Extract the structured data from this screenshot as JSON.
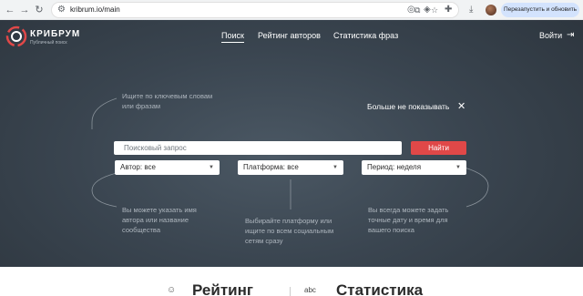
{
  "browser": {
    "url": "kribrum.io/main",
    "relaunch_label": "Перезапустить и обновить"
  },
  "header": {
    "brand": "КРИБРУМ",
    "brand_sub": "Публичный поиск",
    "nav": [
      {
        "label": "Поиск",
        "active": true
      },
      {
        "label": "Рейтинг авторов",
        "active": false
      },
      {
        "label": "Статистика фраз",
        "active": false
      }
    ],
    "login_label": "Войти"
  },
  "hints": {
    "search": "Ищите по ключевым словам или фразам",
    "author": "Вы можете указать имя автора или название сообщества",
    "platform": "Выбирайте платформу или ищите по всем социальным сетям сразу",
    "period": "Вы всегда можете задать точные дату и время для вашего поиска"
  },
  "dismiss_label": "Больше не показывать",
  "search": {
    "placeholder": "Поисковый запрос",
    "button_label": "Найти"
  },
  "filters": [
    {
      "label": "Автор: все"
    },
    {
      "label": "Платформа: все"
    },
    {
      "label": "Период: неделя"
    }
  ],
  "bottom": {
    "rating_title": "Рейтинг",
    "stats_title": "Статистика",
    "stats_icon_text": "abc"
  },
  "colors": {
    "accent": "#e04848",
    "hero_bg": "#3a4550"
  }
}
